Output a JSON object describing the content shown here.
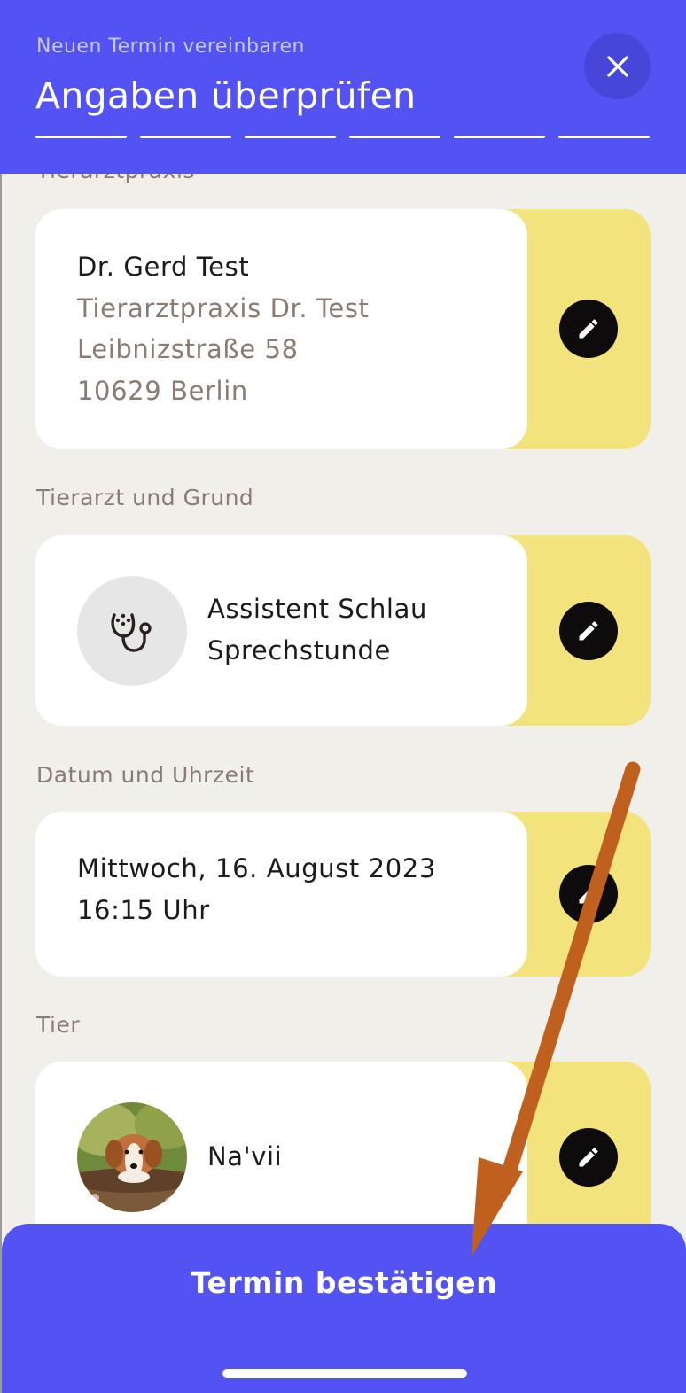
{
  "header": {
    "subtitle": "Neuen Termin vereinbaren",
    "title": "Angaben überprüfen",
    "steps_total": 6,
    "steps_completed": 6
  },
  "sections": {
    "practice": {
      "label": "Tierarztpraxis",
      "name": "Dr. Gerd Test",
      "practice_name": "Tierarztpraxis Dr. Test",
      "street": "Leibnizstraße 58",
      "city": "10629 Berlin"
    },
    "vet_reason": {
      "label": "Tierarzt und Grund",
      "vet": "Assistent Schlau",
      "reason": "Sprechstunde",
      "icon": "stethoscope-icon"
    },
    "datetime": {
      "label": "Datum und Uhrzeit",
      "date": "Mittwoch, 16. August 2023",
      "time": "16:15 Uhr"
    },
    "pet": {
      "label": "Tier",
      "name": "Na'vii"
    }
  },
  "actions": {
    "confirm": "Termin bestätigen"
  },
  "colors": {
    "primary": "#5353f4",
    "edit_accent": "#f3e37c",
    "background": "#f1efea",
    "annotation_arrow": "#c0601e"
  }
}
